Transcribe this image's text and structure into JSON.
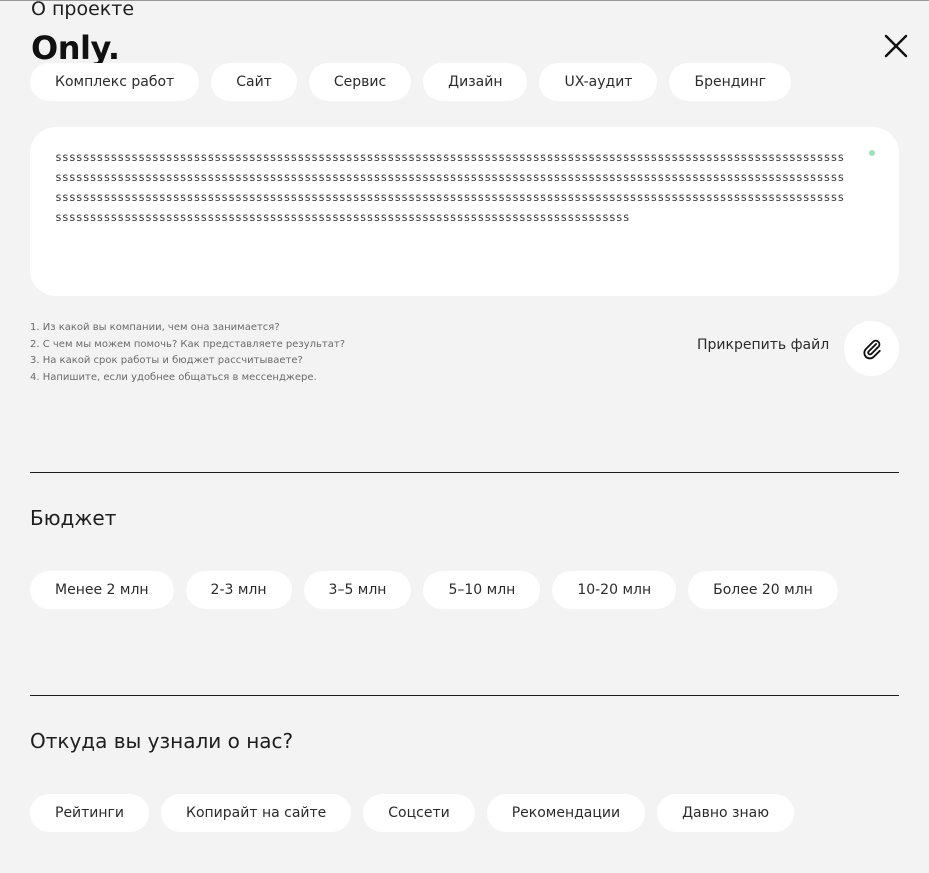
{
  "header": {
    "section_title": "О проекте",
    "logo": "Only.",
    "close_icon": "close-icon"
  },
  "services": {
    "chips": [
      "Комплекс работ",
      "Сайт",
      "Сервис",
      "Дизайн",
      "UX-аудит",
      "Брендинг"
    ]
  },
  "description": {
    "value": "sssssssssssssssssssssssssssssssssssssssssssssssssssssssssssssssssssssssssssssssssssssssssssssssssssssssssssssssssssssssssssssssssssssssssssssssssssssssssssssssssssssssssssssssssssssssssssssssssssssssssssssssssssssssssssssssssssssssssssssssssssssssssssssssssssssssssssssssssssssssssssssssssssssssssssssssssssssssssssssssssssssssssssssssssssssssssssssssssssssssssssssssssssssssssssssssssssssssssssssssssssssssssssssssssssssssss",
    "hints": [
      "1. Из какой вы компании, чем она занимается?",
      "2. С чем мы можем помочь? Как представляете результат?",
      "3. На какой срок работы и бюджет рассчитываете?",
      "4. Напишите, если удобнее общаться в мессенджере."
    ],
    "attach_label": "Прикрепить файл",
    "attach_icon": "paperclip-icon",
    "indicator_color": "#9be3b7"
  },
  "budget": {
    "title": "Бюджет",
    "chips": [
      "Менее 2 млн",
      "2-3 млн",
      "3–5 млн",
      "5–10 млн",
      "10-20 млн",
      "Более 20 млн"
    ]
  },
  "source": {
    "title": "Откуда вы узнали о нас?",
    "chips": [
      "Рейтинги",
      "Копирайт на сайте",
      "Соцсети",
      "Рекомендации",
      "Давно знаю"
    ]
  },
  "colors": {
    "background": "#f3f3f3",
    "chip": "#ffffff",
    "text": "#1e1e1e"
  }
}
